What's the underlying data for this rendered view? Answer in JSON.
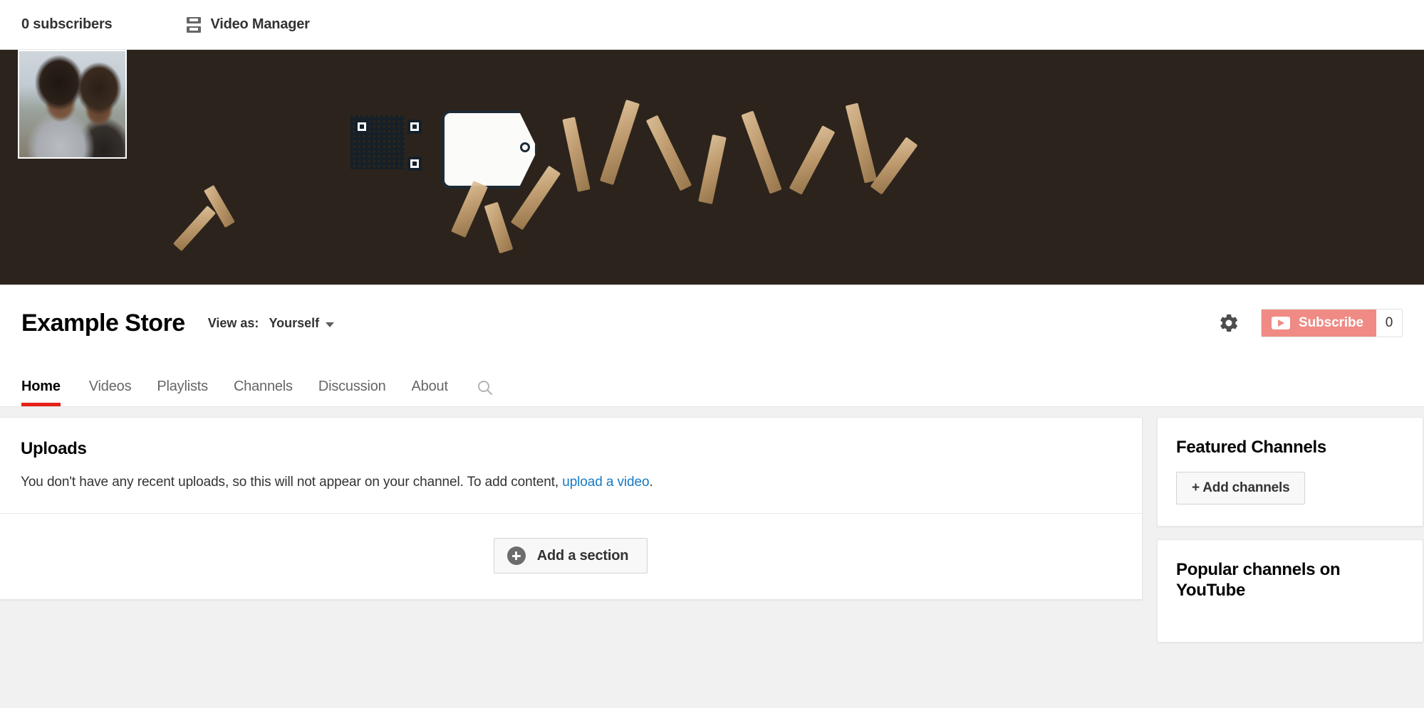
{
  "topbar": {
    "subscribers": "0 subscribers",
    "video_manager_label": "Video Manager",
    "video_manager_icon": "video-list-icon"
  },
  "banner": {
    "avatar_alt": "channel-avatar",
    "description": "White cosmetic jars with QR code tag, brown paper shred and gold tray"
  },
  "channel": {
    "title": "Example Store",
    "view_as_label": "View as:",
    "view_as_value": "Yourself",
    "settings_icon": "gear-icon",
    "subscribe_label": "Subscribe",
    "subscribe_count": "0",
    "subscribe_color": "#f08a84",
    "play_icon": "youtube-play-icon"
  },
  "tabs": {
    "items": [
      {
        "label": "Home",
        "active": true
      },
      {
        "label": "Videos",
        "active": false
      },
      {
        "label": "Playlists",
        "active": false
      },
      {
        "label": "Channels",
        "active": false
      },
      {
        "label": "Discussion",
        "active": false
      },
      {
        "label": "About",
        "active": false
      }
    ],
    "search_icon": "search-icon",
    "active_underline_color": "#e62117"
  },
  "uploads": {
    "title": "Uploads",
    "empty_text_before": "You don't have any recent uploads, so this will not appear on your channel. To add content, ",
    "empty_link": "upload a video",
    "empty_text_after": ".",
    "link_color": "#167ac6",
    "add_section_label": "Add a section",
    "add_section_icon": "plus-circle-icon"
  },
  "sidebar": {
    "featured": {
      "title": "Featured Channels",
      "add_label": "+ Add channels"
    },
    "popular": {
      "title": "Popular channels on YouTube"
    }
  },
  "colors": {
    "page_background": "#f1f1f1",
    "card_background": "#ffffff",
    "text_primary": "#030303",
    "text_secondary": "#666666"
  }
}
